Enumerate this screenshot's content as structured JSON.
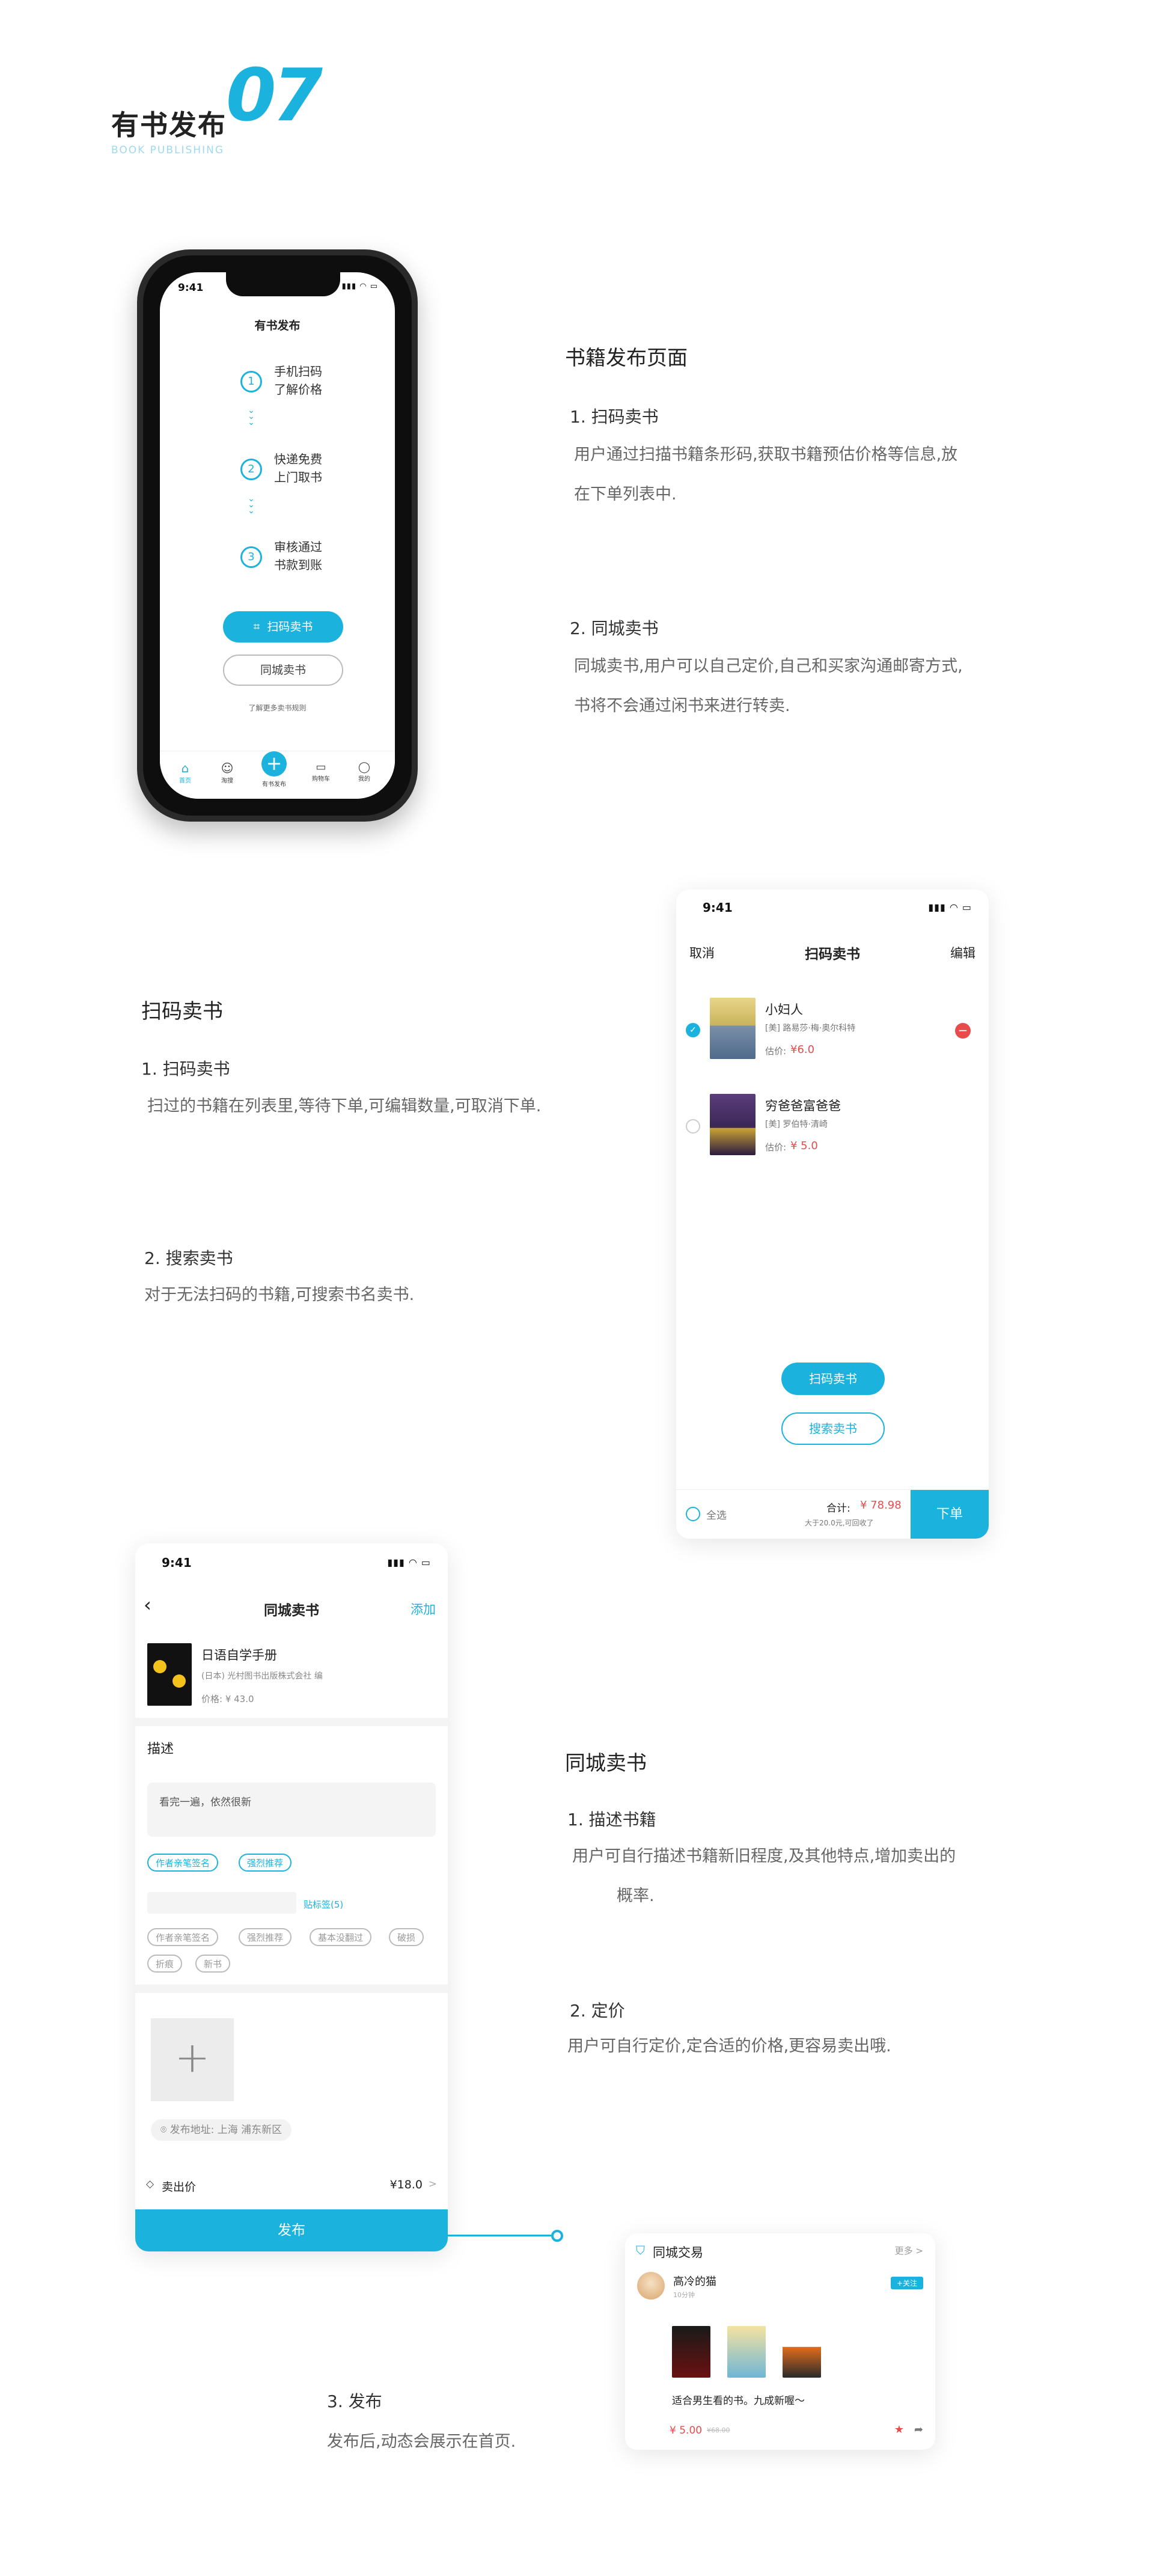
{
  "header": {
    "title": "有书发布",
    "number": "07",
    "subtitle": "BOOK PUBLISHING"
  },
  "section1": {
    "heading": "书籍发布页面",
    "item1_title": "1. 扫码卖书",
    "item1_line1": "用户通过扫描书籍条形码,获取书籍预估价格等信息,放",
    "item1_line2": "在下单列表中.",
    "item2_title": "2. 同城卖书",
    "item2_line1": "同城卖书,用户可以自己定价,自己和买家沟通邮寄方式,",
    "item2_line2": "书将不会通过闲书来进行转卖."
  },
  "phone": {
    "time": "9:41",
    "title": "有书发布",
    "steps": [
      {
        "num": "1",
        "line1": "手机扫码",
        "line2": "了解价格"
      },
      {
        "num": "2",
        "line1": "快递免费",
        "line2": "上门取书"
      },
      {
        "num": "3",
        "line1": "审核通过",
        "line2": "书款到账"
      }
    ],
    "scan_button": "扫码卖书",
    "city_button": "同城卖书",
    "rules_link": "了解更多卖书规则",
    "tabs": [
      "首页",
      "淘搜",
      "有书发布",
      "购物车",
      "我的"
    ]
  },
  "section2": {
    "heading": "扫码卖书",
    "item1_title": "1. 扫码卖书",
    "item1_line1": "扫过的书籍在列表里,等待下单,可编辑数量,可取消下单.",
    "item2_title": "2. 搜索卖书",
    "item2_line1": "对于无法扫码的书籍,可搜索书名卖书."
  },
  "scan": {
    "time": "9:41",
    "cancel": "取消",
    "title": "扫码卖书",
    "edit": "编辑",
    "books": [
      {
        "title": "小妇人",
        "author": "[美] 路易莎·梅·奥尔科特",
        "price_label": "估价:",
        "price": "¥6.0",
        "checked": true
      },
      {
        "title": "穷爸爸富爸爸",
        "author": "[美] 罗伯特·清崎",
        "price_label": "估价:",
        "price": "¥ 5.0",
        "checked": false
      }
    ],
    "scan_button": "扫码卖书",
    "search_button": "搜索卖书",
    "select_all": "全选",
    "total_label": "合计:",
    "total_value": "¥ 78.98",
    "total_note": "大于20.0元,可回收了",
    "order_button": "下单"
  },
  "section3": {
    "heading": "同城卖书",
    "item1_title": "1. 描述书籍",
    "item1_line1": "用户可自行描述书籍新旧程度,及其他特点,增加卖出的",
    "item1_line2": "概率.",
    "item2_title": "2. 定价",
    "item2_line1": "用户可自行定价,定合适的价格,更容易卖出哦.",
    "item3_title": "3. 发布",
    "item3_line1": "发布后,动态会展示在首页."
  },
  "city": {
    "time": "9:41",
    "title": "同城卖书",
    "add": "添加",
    "book_title": "日语自学手册",
    "book_publisher": "(日本) 光村图书出版株式会社 编",
    "book_price": "价格: ¥ 43.0",
    "desc_heading": "描述",
    "desc_text": "看完一遍，依然很新",
    "selected_tags": [
      "作者亲笔签名",
      "强烈推荐"
    ],
    "custom_tag": "贴标签(5)",
    "tags": [
      "作者亲笔签名",
      "强烈推荐",
      "基本没翻过",
      "破损",
      "折痕",
      "新书"
    ],
    "address": "发布地址: 上海 浦东新区",
    "price_label": "卖出价",
    "price_value": "¥18.0",
    "publish_button": "发布"
  },
  "feed": {
    "title": "同城交易",
    "more": "更多 >",
    "user": "高冷的猫",
    "user_meta": "10分钟",
    "follow": "+关注",
    "caption": "适合男生看的书。九成新喔～",
    "price": "¥ 5.00",
    "old_price": "¥68.00"
  },
  "colors": {
    "accent": "#1bb3de",
    "price_red": "#e84b4b"
  }
}
